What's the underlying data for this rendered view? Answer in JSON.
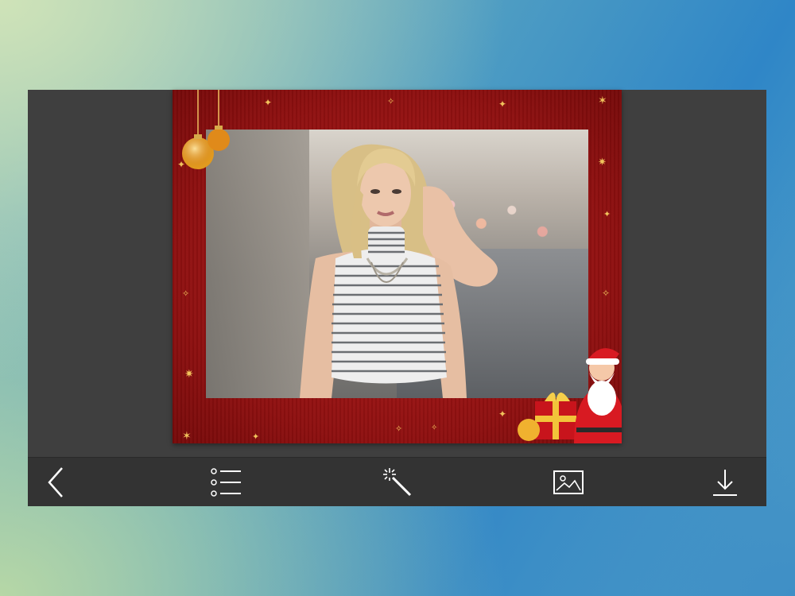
{
  "app": {
    "screen": "frame-editor",
    "colors": {
      "frame_red": "#a01515",
      "gold": "#e8b64a",
      "toolbar": "#333333",
      "canvas": "#3f3f3f"
    }
  },
  "toolbar": {
    "items": [
      {
        "icon": "chevron-left-icon"
      },
      {
        "icon": "list-icon"
      },
      {
        "icon": "magic-wand-icon"
      },
      {
        "icon": "image-icon"
      },
      {
        "icon": "download-icon"
      }
    ]
  },
  "frame": {
    "theme": "christmas",
    "decorations": [
      "ornament-balls",
      "stars",
      "santa-with-gifts"
    ]
  }
}
